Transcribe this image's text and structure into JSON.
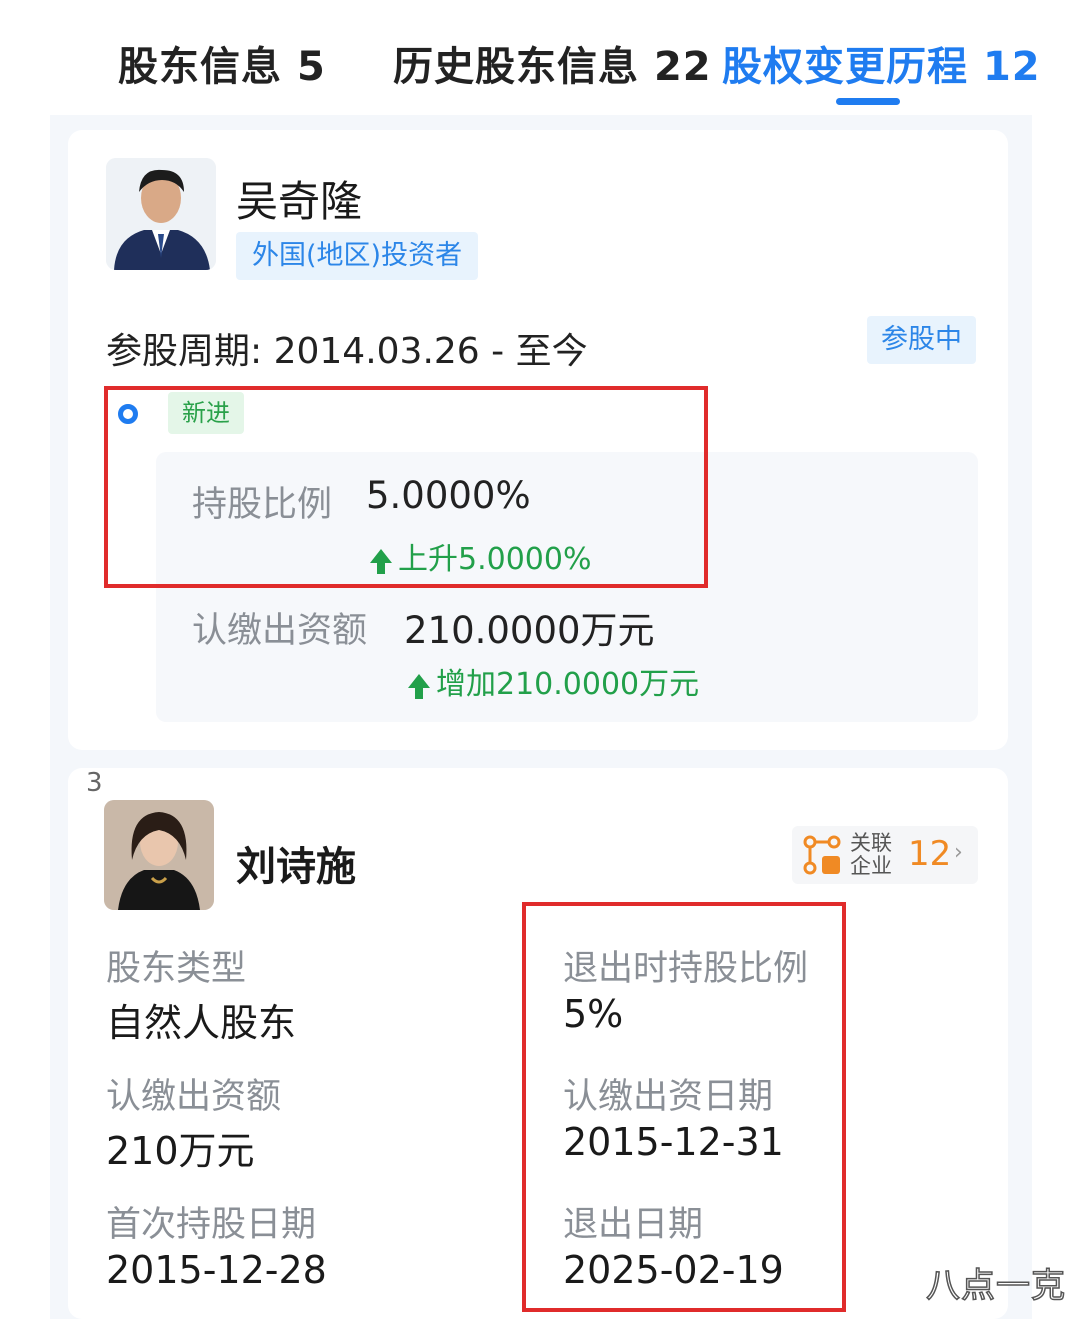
{
  "tabs": [
    {
      "label": "股东信息",
      "count": "5"
    },
    {
      "label": "历史股东信息",
      "count": "22"
    },
    {
      "label": "股权变更历程",
      "count": "12"
    }
  ],
  "card1": {
    "name": "吴奇隆",
    "investor_tag": "外国(地区)投资者",
    "period_label": "参股周期:",
    "period_value": "2014.03.26 - 至今",
    "status_badge": "参股中",
    "change_tag": "新进",
    "share_label": "持股比例",
    "share_value": "5.0000%",
    "share_delta": "上升5.0000%",
    "capital_label": "认缴出资额",
    "capital_value": "210.0000万元",
    "capital_delta": "增加210.0000万元"
  },
  "card2": {
    "index": "3",
    "name": "刘诗施",
    "related": {
      "line1": "关联",
      "line2": "企业",
      "count": "12"
    },
    "type_label": "股东类型",
    "type_value": "自然人股东",
    "capital_label": "认缴出资额",
    "capital_value": "210万元",
    "first_date_label": "首次持股日期",
    "first_date_value": "2015-12-28",
    "exit_share_label": "退出时持股比例",
    "exit_share_value": "5%",
    "sub_date_label": "认缴出资日期",
    "sub_date_value": "2015-12-31",
    "exit_date_label": "退出日期",
    "exit_date_value": "2025-02-19"
  },
  "watermark": "八点一克",
  "colors": {
    "accent": "#1f7cf0",
    "green": "#22a04a",
    "red": "#e02b2b",
    "orange": "#f08a24"
  }
}
